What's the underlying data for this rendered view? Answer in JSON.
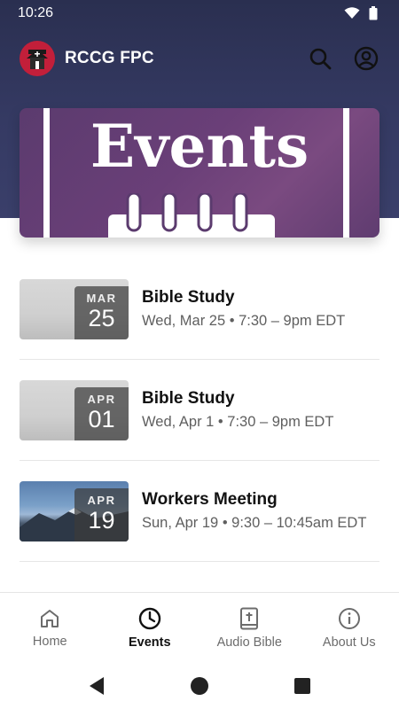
{
  "status_bar": {
    "time": "10:26"
  },
  "app_bar": {
    "title": "RCCG FPC"
  },
  "hero": {
    "title": "Events"
  },
  "events": [
    {
      "month": "MAR",
      "day": "25",
      "title": "Bible Study",
      "subtitle": "Wed, Mar 25 • 7:30 – 9pm EDT",
      "thumb": "gray"
    },
    {
      "month": "APR",
      "day": "01",
      "title": "Bible Study",
      "subtitle": "Wed, Apr 1 • 7:30 – 9pm EDT",
      "thumb": "gray"
    },
    {
      "month": "APR",
      "day": "19",
      "title": "Workers Meeting",
      "subtitle": "Sun, Apr 19 • 9:30 – 10:45am EDT",
      "thumb": "mountain"
    }
  ],
  "bottom_nav": {
    "items": [
      {
        "label": "Home",
        "icon": "home-icon",
        "active": false
      },
      {
        "label": "Events",
        "icon": "clock-icon",
        "active": true
      },
      {
        "label": "Audio Bible",
        "icon": "bible-icon",
        "active": false
      },
      {
        "label": "About Us",
        "icon": "info-icon",
        "active": false
      }
    ]
  },
  "colors": {
    "header_bg": "#353a63",
    "hero_bg": "#6a3f78",
    "logo_red": "#c21f3a",
    "active_nav": "#111111",
    "inactive_nav": "#6c6c6c"
  }
}
